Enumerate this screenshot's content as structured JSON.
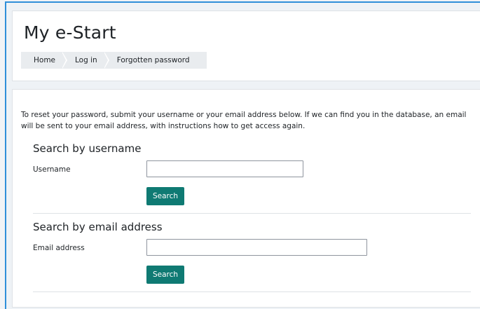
{
  "header": {
    "title": "My e-Start",
    "breadcrumb": [
      "Home",
      "Log in",
      "Forgotten password"
    ]
  },
  "main": {
    "intro": "To reset your password, submit your username or your email address below. If we can find you in the database, an email will be sent to your email address, with instructions how to get access again.",
    "username_section": {
      "title": "Search by username",
      "label": "Username",
      "value": "",
      "button": "Search"
    },
    "email_section": {
      "title": "Search by email address",
      "label": "Email address",
      "value": "",
      "button": "Search"
    }
  },
  "colors": {
    "accent_button": "#0f7a73",
    "frame_border": "#2f8fd9"
  }
}
